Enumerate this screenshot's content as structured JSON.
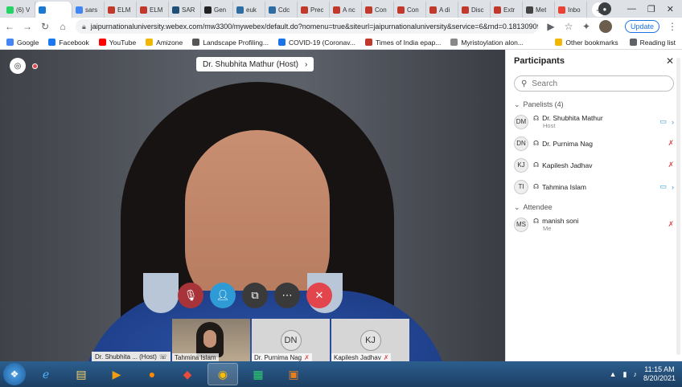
{
  "browser": {
    "tabs": [
      {
        "label": "(6) V",
        "color": "#25d366"
      },
      {
        "label": "",
        "color": "#1b7acf",
        "active": true
      },
      {
        "label": "sars",
        "color": "#4285f4"
      },
      {
        "label": "ELM",
        "color": "#c0392b"
      },
      {
        "label": "ELM",
        "color": "#c0392b"
      },
      {
        "label": "SAR",
        "color": "#1f4e79"
      },
      {
        "label": "Gen",
        "color": "#222222"
      },
      {
        "label": "euk",
        "color": "#2e6da4"
      },
      {
        "label": "Cdc",
        "color": "#2e6da4"
      },
      {
        "label": "Prec",
        "color": "#c0392b"
      },
      {
        "label": "A nc",
        "color": "#c0392b"
      },
      {
        "label": "Con",
        "color": "#c0392b"
      },
      {
        "label": "Con",
        "color": "#c0392b"
      },
      {
        "label": "A di",
        "color": "#c0392b"
      },
      {
        "label": "Disc",
        "color": "#c0392b"
      },
      {
        "label": "Extr",
        "color": "#c0392b"
      },
      {
        "label": "Met",
        "color": "#444444"
      },
      {
        "label": "Inbo",
        "color": "#ea4335"
      }
    ],
    "new_tab": "+",
    "url": "jaipurnationaluniversity.webex.com/mw3300/mywebex/default.do?nomenu=true&siteurl=jaipurnationaluniversity&service=6&rnd=0.1813090986960441...",
    "update_label": "Update",
    "bookmarks": [
      {
        "label": "Google",
        "color": "#4285f4"
      },
      {
        "label": "Facebook",
        "color": "#1877f2"
      },
      {
        "label": "YouTube",
        "color": "#ff0000"
      },
      {
        "label": "Amizone",
        "color": "#f2b705"
      },
      {
        "label": "Landscape Profiling...",
        "color": "#555555"
      },
      {
        "label": "COVID-19 (Coronav...",
        "color": "#1a73e8"
      },
      {
        "label": "Times of India epap...",
        "color": "#c0392b"
      },
      {
        "label": "Myristoylation alon...",
        "color": "#888888"
      }
    ],
    "other_bookmarks": "Other bookmarks",
    "reading_list": "Reading list"
  },
  "meeting": {
    "speaker_label": "Dr. Shubhita Mathur (Host)",
    "thumbnails": [
      {
        "name": "Tahmina Islam",
        "initials": "",
        "self": true
      },
      {
        "name": "Dr. Purnima Nag",
        "initials": "DN"
      },
      {
        "name": "Kapilesh Jadhav",
        "initials": "KJ"
      }
    ],
    "active_speaker_strip": "Dr. Shubhita ... (Host)"
  },
  "participants": {
    "title": "Participants",
    "search_placeholder": "Search",
    "panelists_label": "Panelists (4)",
    "panelists": [
      {
        "initials": "DM",
        "name": "Dr. Shubhita Mathur",
        "role": "Host",
        "status": "cam-on"
      },
      {
        "initials": "DN",
        "name": "Dr. Purnima Nag",
        "role": "",
        "status": "mic-off"
      },
      {
        "initials": "KJ",
        "name": "Kapilesh Jadhav",
        "role": "",
        "status": "mic-off"
      },
      {
        "initials": "TI",
        "name": "Tahmina Islam",
        "role": "",
        "status": "cam-on"
      }
    ],
    "attendee_label": "Attendee",
    "attendees": [
      {
        "initials": "MS",
        "name": "manish soni",
        "role": "Me",
        "status": "mic-off"
      }
    ]
  },
  "taskbar": {
    "time": "11:15 AM",
    "date": "8/20/2021"
  }
}
